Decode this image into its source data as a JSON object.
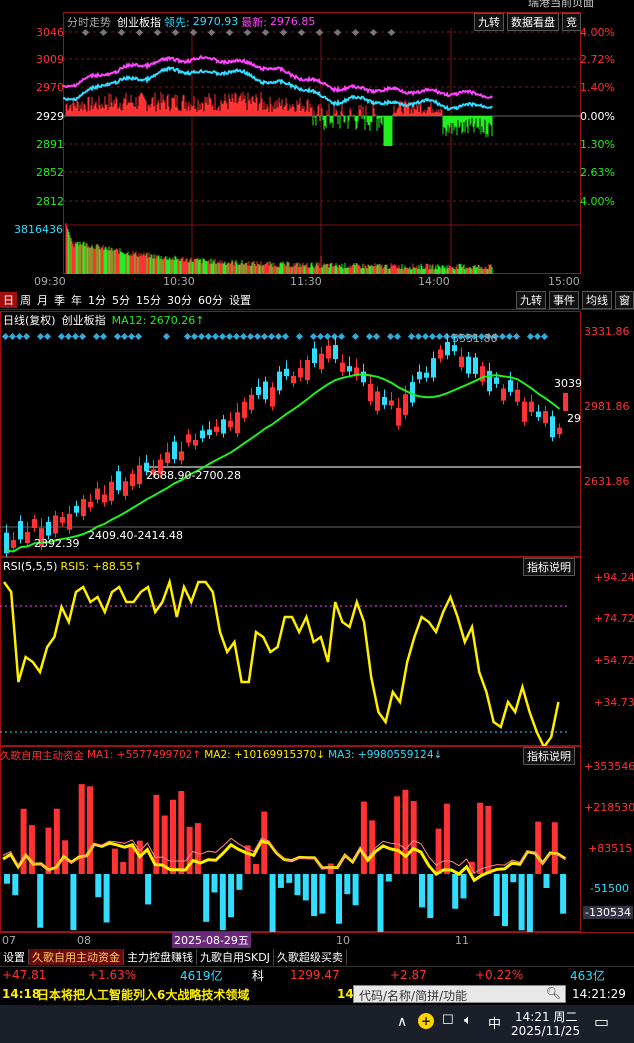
{
  "window": {
    "title_fragment": "瑞港当前页面"
  },
  "intraday": {
    "title": "分时走势",
    "index_name": "创业板指",
    "leader_label": "领先:",
    "leader_value": "2970.93",
    "latest_label": "最新:",
    "latest_value": "2976.85",
    "buttons": [
      "九转",
      "数据看盘",
      "竞"
    ],
    "price_ticks": [
      "3046",
      "3009",
      "2970",
      "2929",
      "2891",
      "2852",
      "2812"
    ],
    "pct_ticks": [
      "4.00%",
      "2.72%",
      "1.40%",
      "0.00%",
      "1.30%",
      "2.63%",
      "4.00%"
    ],
    "volume_tick": "3816436",
    "time_ticks": [
      "09:30",
      "10:30",
      "11:30",
      "14:00",
      "15:00"
    ]
  },
  "toolbar": {
    "periods": [
      "日",
      "周",
      "月",
      "季",
      "年",
      "1分",
      "5分",
      "15分",
      "30分",
      "60分",
      "设置"
    ],
    "active_period": "日",
    "right_buttons": [
      "九转",
      "事件",
      "均线",
      "窗"
    ]
  },
  "kline": {
    "title": "日线(复权)",
    "index_name": "创业板指",
    "ma_label": "MA12: 2670.26↑",
    "price_ticks": [
      "3331.86",
      "2981.86",
      "2631.86"
    ],
    "annot_high": "3331.86",
    "annot_right1": "3039",
    "annot_right2": "29",
    "range_mid": "2688.90-2700.28",
    "range_low": "2409.40-2414.48",
    "range_low_left": "2392.39"
  },
  "rsi": {
    "title": "RSI(5,5,5)",
    "value_label": "RSI5: +88.55↑",
    "explain_button": "指标说明",
    "ticks": [
      "+94.24",
      "+74.72",
      "+54.72",
      "+34.73"
    ]
  },
  "money": {
    "title": "久歌自用主动资金",
    "ma1": "MA1: +5577499702↑",
    "ma2": "MA2: +10169915370↓",
    "ma3": "MA3: +9980559124↓",
    "explain_button": "指标说明",
    "ticks": [
      "+353546",
      "+218530",
      "+83515",
      "-51500",
      "-130534"
    ]
  },
  "dates": {
    "labels": [
      "07",
      "08",
      "2025-08-29五",
      "10",
      "11"
    ]
  },
  "tabs": [
    "设置",
    "久歌自用主动资金",
    "主力控盘赚钱",
    "九歌自用SKDJ",
    "久歌超级买卖"
  ],
  "active_tab": "久歌自用主动资金",
  "quote_bar": {
    "chg": "+47.81",
    "pct": "+1.63%",
    "amount": "4619亿",
    "market": "科",
    "price2": "1299.47",
    "chg2": "+2.87",
    "pct2": "+0.22%",
    "amount2": "463亿"
  },
  "news": {
    "time": "14:18",
    "text": "日本将把人工智能列入6大战略技术领域",
    "prefix2": "14",
    "search_placeholder": "代码/名称/简拼/功能",
    "clock": "14:21:29"
  },
  "taskbar": {
    "time": "14:21 周二",
    "date": "2025/11/25"
  },
  "colors": {
    "red": "#ff3333",
    "green": "#22ee22",
    "cyan": "#33ddff",
    "magenta": "#ff44ff",
    "yellow": "#ffee00",
    "border": "#a01010"
  }
}
